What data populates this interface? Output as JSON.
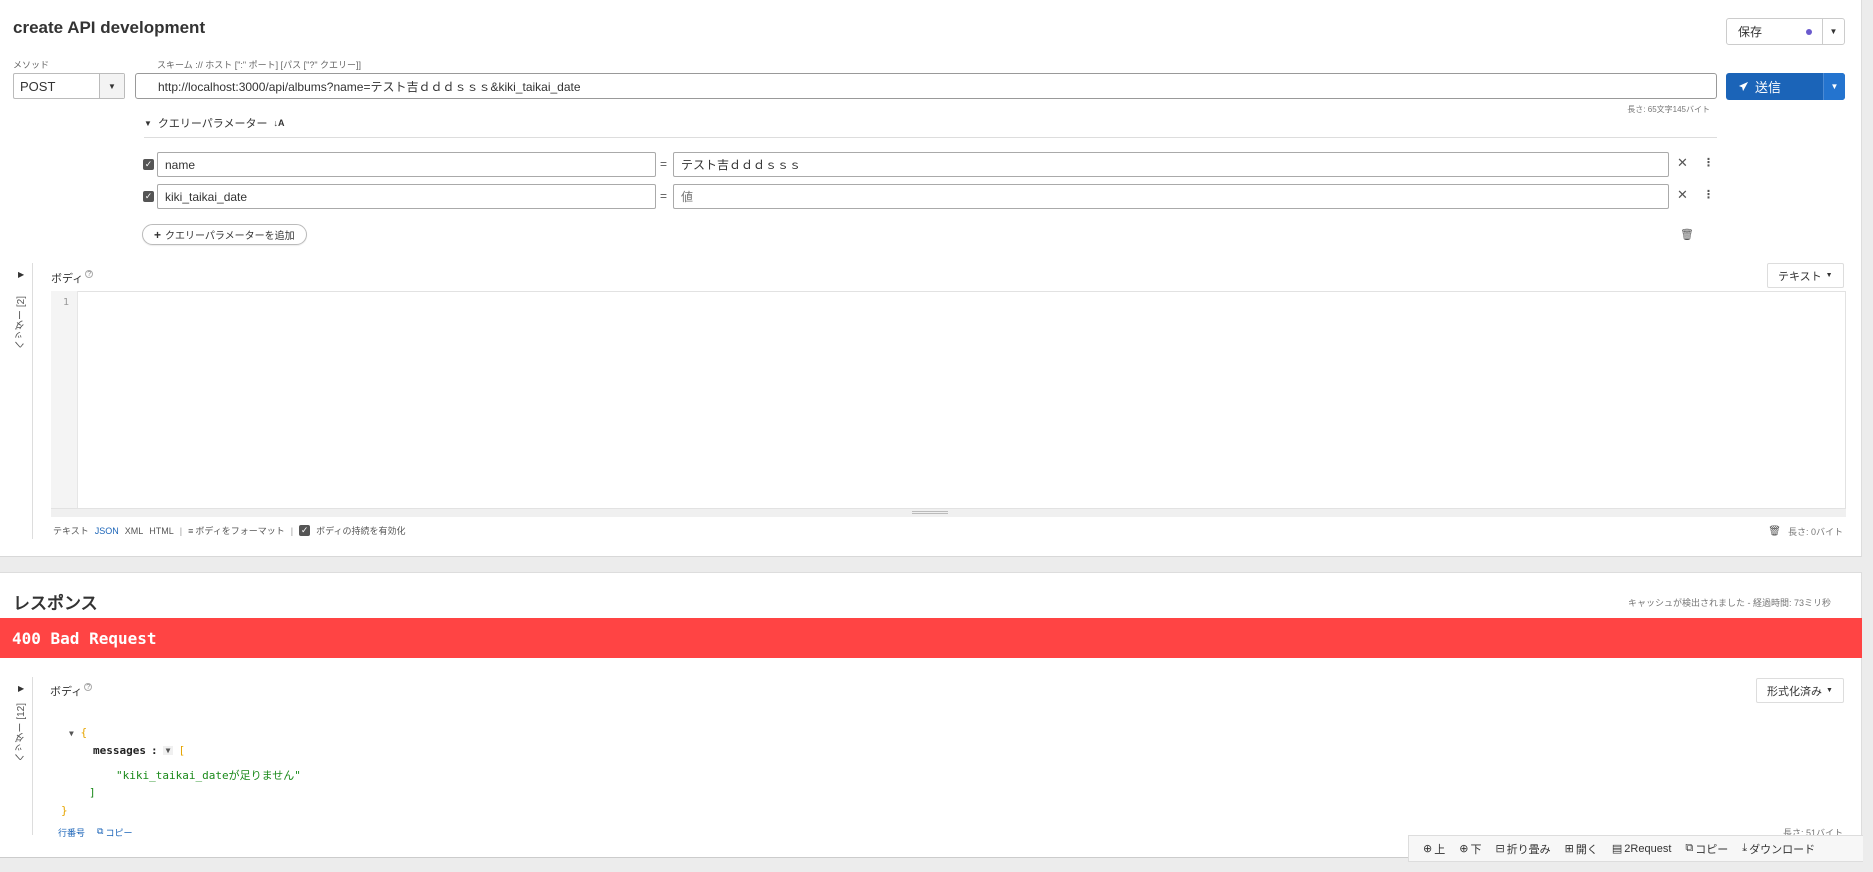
{
  "request": {
    "title": "create API development",
    "save_label": "保存",
    "method_label": "メソッド",
    "scheme_label": "スキーム :// ホスト [\":\" ポート] [パス [\"?\" クエリー]]",
    "method_value": "POST",
    "url": "http://localhost:3000/api/albums?name=テスト吉ｄｄｄｓｓｓ&kiki_taikai_date",
    "send_label": "送信",
    "url_length": "長さ: 65文字145バイト",
    "query_params": {
      "header": "クエリーパラメーター",
      "sort_icon": "↓A",
      "rows": [
        {
          "name": "name",
          "value": "テスト吉ｄｄｄｓｓｓ",
          "value_placeholder": "",
          "checked": true
        },
        {
          "name": "kiki_taikai_date",
          "value": "",
          "value_placeholder": "値",
          "checked": true
        }
      ],
      "add_label": "クエリーパラメーターを追加"
    },
    "headers_tab": "ヘッダー [2]",
    "body": {
      "label": "ボディ",
      "type_dropdown": "テキスト",
      "line_number": "1",
      "formats": [
        "テキスト",
        "JSON",
        "XML",
        "HTML"
      ],
      "active_format": "JSON",
      "format_body": "ボディをフォーマット",
      "enable_body_label": "ボディの持続を有効化",
      "length": "長さ: 0バイト"
    }
  },
  "response": {
    "title": "レスポンス",
    "cache_info": "キャッシュが検出されました - 経過時間: 73ミリ秒",
    "status": "400 Bad Request",
    "status_color": "#ff4444",
    "headers_tab": "ヘッダー [12]",
    "body_label": "ボディ",
    "view_dropdown": "形式化済み",
    "json": {
      "open_brace": "{",
      "key": "messages",
      "colon": ":",
      "open_bracket": "[",
      "string_value": "\"kiki_taikai_dateが足りません\"",
      "close_bracket": "]",
      "close_brace": "}"
    },
    "footer_links": [
      "行番号",
      "コピー"
    ],
    "length": "長さ: 51バイト"
  },
  "bottom_toolbar": [
    "上",
    "下",
    "折り畳み",
    "開く",
    "2Request",
    "コピー",
    "ダウンロード"
  ],
  "colors": {
    "primary": "#1b64b8",
    "error": "#ff4444",
    "json_string": "#1a8a1a",
    "json_brace": "#e6a500"
  }
}
